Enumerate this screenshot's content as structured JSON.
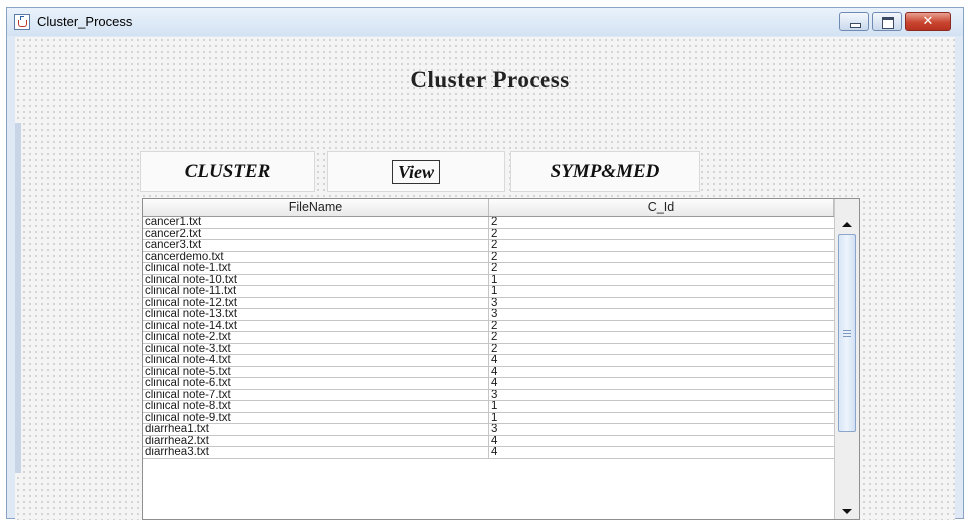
{
  "window": {
    "title": "Cluster_Process"
  },
  "controls": {
    "close_glyph": "✕"
  },
  "page": {
    "heading": "Cluster Process"
  },
  "nav": {
    "cluster": "CLUSTER",
    "view": "View",
    "symp_med": "SYMP&MED"
  },
  "table": {
    "columns": [
      "FileName",
      "C_Id"
    ],
    "rows": [
      [
        "cancer1.txt",
        "2"
      ],
      [
        "cancer2.txt",
        "2"
      ],
      [
        "cancer3.txt",
        "2"
      ],
      [
        "cancerdemo.txt",
        "2"
      ],
      [
        "clinical note-1.txt",
        "2"
      ],
      [
        "clinical note-10.txt",
        "1"
      ],
      [
        "clinical note-11.txt",
        "1"
      ],
      [
        "clinical note-12.txt",
        "3"
      ],
      [
        "clinical note-13.txt",
        "3"
      ],
      [
        "clinical note-14.txt",
        "2"
      ],
      [
        "clinical note-2.txt",
        "2"
      ],
      [
        "clinical note-3.txt",
        "2"
      ],
      [
        "clinical note-4.txt",
        "4"
      ],
      [
        "clinical note-5.txt",
        "4"
      ],
      [
        "clinical note-6.txt",
        "4"
      ],
      [
        "clinical note-7.txt",
        "3"
      ],
      [
        "clinical note-8.txt",
        "1"
      ],
      [
        "clinical note-9.txt",
        "1"
      ],
      [
        "diarrhea1.txt",
        "3"
      ],
      [
        "diarrhea2.txt",
        "4"
      ],
      [
        "diarrhea3.txt",
        "4"
      ]
    ]
  },
  "colors": {
    "title_bar": "#d3e2f3",
    "close_button": "#c9452f",
    "scroll_thumb": "#d8e6f7"
  }
}
